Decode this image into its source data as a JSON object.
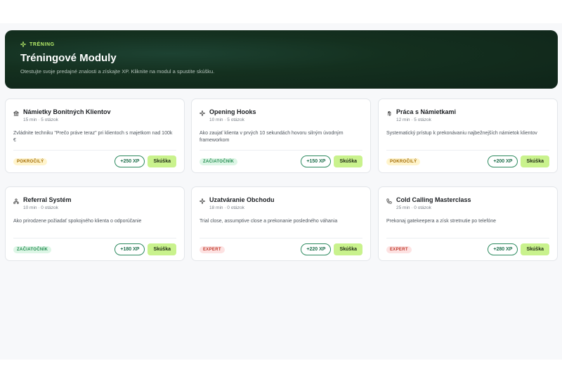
{
  "hero": {
    "eyebrow": "TRÉNING",
    "title": "Tréningové Moduly",
    "subtitle": "Otestujte svoje predajné znalosti a získajte XP. Kliknite na modul a spustite skúšku."
  },
  "colors": {
    "accent": "#c9f28d",
    "hero_bg": "#14301f",
    "xp_border": "#2d8a5f"
  },
  "modules": [
    {
      "icon": "bank-icon",
      "title": "Námietky Bonitných Klientov",
      "meta": "15 min · 5 otázok",
      "description": "Zvládnite techniku \"Prečo práve teraz\" pri klientoch s majetkom nad 100k €",
      "level": "POKROČILÝ",
      "xp": "+250 XP",
      "action": "Skúška"
    },
    {
      "icon": "sparkle-icon",
      "title": "Opening Hooks",
      "meta": "10 min · 5 otázok",
      "description": "Ako zaujať klienta v prvých 10 sekundách hovoru silným úvodným frameworkom",
      "level": "ZAČIATOČNÍK",
      "xp": "+150 XP",
      "action": "Skúška"
    },
    {
      "icon": "hand-icon",
      "title": "Práca s Námietkami",
      "meta": "12 min · 5 otázok",
      "description": "Systematický prístup k prekonávaniu najbežnejších námietok klientov",
      "level": "POKROČILÝ",
      "xp": "+200 XP",
      "action": "Skúška"
    },
    {
      "icon": "network-icon",
      "title": "Referral Systém",
      "meta": "10 min · 0 otázok",
      "description": "Ako prirodzene požiadať spokojného klienta o odporúčanie",
      "level": "ZAČIATOČNÍK",
      "xp": "+180 XP",
      "action": "Skúška"
    },
    {
      "icon": "sparkle-icon",
      "title": "Uzatváranie Obchodu",
      "meta": "18 min · 0 otázok",
      "description": "Trial close, assumptive close a prekonanie posledného váhania",
      "level": "EXPERT",
      "xp": "+220 XP",
      "action": "Skúška"
    },
    {
      "icon": "phone-icon",
      "title": "Cold Calling Masterclass",
      "meta": "25 min · 0 otázok",
      "description": "Prekonaj gatekeepera a získ stretnutie po telefóne",
      "level": "EXPERT",
      "xp": "+280 XP",
      "action": "Skúška"
    }
  ]
}
